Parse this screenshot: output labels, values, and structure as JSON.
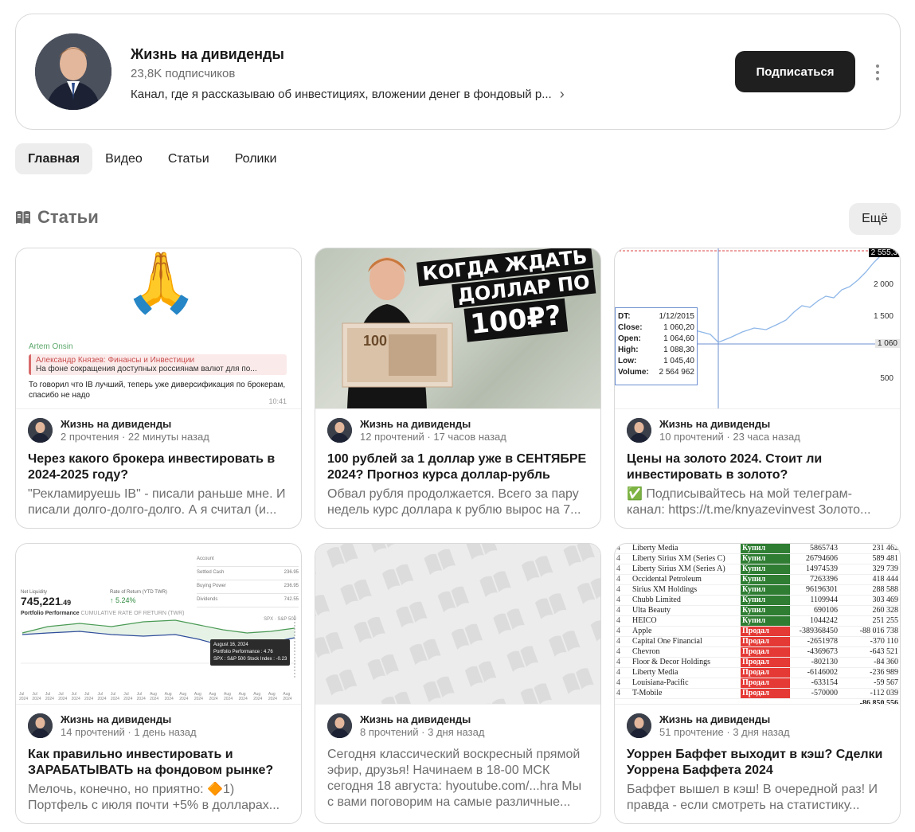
{
  "channel": {
    "title": "Жизнь на дивиденды",
    "subscribers": "23,8K подписчиков",
    "description": "Канал, где я рассказываю об инвестициях, вложении денег в фондовый р...",
    "subscribe_label": "Подписаться"
  },
  "tabs": [
    {
      "label": "Главная",
      "active": true
    },
    {
      "label": "Видео",
      "active": false
    },
    {
      "label": "Статьи",
      "active": false
    },
    {
      "label": "Ролики",
      "active": false
    }
  ],
  "section": {
    "title": "Статьи",
    "more_label": "Ещё",
    "icon": "article-book-icon"
  },
  "articles": [
    {
      "author": "Жизнь на дивиденды",
      "stats": "2 прочтения · 22 минуты назад",
      "title": "Через какого брокера инвестировать в 2024-2025 году?",
      "excerpt": "\"Рекламируешь IB\" - писали раньше мне. И писали долго-долго-долго. А я считал (и...",
      "thumb": {
        "emoji": "🙏",
        "sender": "Artem Onsin",
        "quote_author": "Александр Князев: Финансы и Инвестиции",
        "quote_text": "На фоне сокращения доступных россиянам валют для по...",
        "message": "То говорил что IB лучший, теперь уже диверсификация по брокерам, спасибо не надо",
        "time": "10:41"
      }
    },
    {
      "author": "Жизнь на дивиденды",
      "stats": "12 прочтений · 17 часов назад",
      "title": "100 рублей за 1 доллар уже в СЕНТЯБРЕ 2024? Прогноз курса доллар-рубль",
      "excerpt": "Обвал рубля продолжается. Всего за пару недель курс доллара к рублю вырос на 7...",
      "thumb": {
        "line1": "КОГДА ЖДАТЬ",
        "line2": "ДОЛЛАР ПО",
        "line3": "100₽?",
        "banknote": "100"
      }
    },
    {
      "author": "Жизнь на дивиденды",
      "stats": "10 прочтений · 23 часа назад",
      "title": "Цены на золото 2024. Стоит ли инвестировать в золото?",
      "excerpt": "✅ Подписывайтесь на мой телеграм-канал: https://t.me/knyazevinvest Золото...",
      "thumb": {
        "info": [
          {
            "k": "DT:",
            "v": "1/12/2015"
          },
          {
            "k": "Close:",
            "v": "1 060,20"
          },
          {
            "k": "Open:",
            "v": "1 064,60"
          },
          {
            "k": "High:",
            "v": "1 088,30"
          },
          {
            "k": "Low:",
            "v": "1 045,40"
          },
          {
            "k": "Volume:",
            "v": "2 564 962"
          }
        ],
        "axis": [
          "2 000",
          "1 500",
          "500"
        ],
        "tag_top": "2 555,3",
        "tag_mid": "1 060"
      }
    },
    {
      "author": "Жизнь на дивиденды",
      "stats": "14 прочтений · 1 день назад",
      "title": "Как правильно инвестировать и ЗАРАБАТЫВАТЬ на фондовом рынке?",
      "excerpt": "Мелочь, конечно, но приятно: 🔶1) Портфель с июля почти +5% в долларах...",
      "thumb": {
        "account_title": "Account",
        "account_rows": [
          {
            "k": "Settled Cash",
            "v": "236.95"
          },
          {
            "k": "Buying Power",
            "v": "236.95"
          },
          {
            "k": "Dividends",
            "v": "742.55"
          }
        ],
        "liq_label": "Net Liquidity",
        "liq_value": "745,221",
        "liq_cents": ".49",
        "ret_label": "Rate of Return (YTD TWR)",
        "ret_value": "5.24%",
        "perf_title": "Portfolio Performance",
        "perf_sub": "CUMULATIVE RATE OF RETURN (TWR)",
        "spx": "SPX · S&P 500",
        "tip_date": "August 16, 2024",
        "tip_line1": "Portfolio Performance : 4.76",
        "tip_line2": "SPX : S&P 500 Stock Index : -0.23",
        "months": [
          "Jul 2024",
          "Jul 2024",
          "Jul 2024",
          "Jul 2024",
          "Jul 2024",
          "Jul 2024",
          "Jul 2024",
          "Jul 2024",
          "Jul 2024",
          "Jul 2024",
          "Aug 2024",
          "Aug 2024",
          "Aug 2024",
          "Aug 2024",
          "Aug 2024",
          "Aug 2024",
          "Aug 2024",
          "Aug 2024",
          "Aug 2024",
          "Aug 2024"
        ]
      }
    },
    {
      "author": "Жизнь на дивиденды",
      "stats": "8 прочтений · 3 дня назад",
      "title": "",
      "excerpt": "Сегодня классический воскресный прямой эфир, друзья! Начинаем в 18-00 МСК сегодня 18 августа: hyoutube.com/...hra Мы с вами поговорим на самые различные..."
    },
    {
      "author": "Жизнь на дивиденды",
      "stats": "51 прочтение · 3 дня назад",
      "title": "Уоррен Баффет выходит в кэш? Сделки Уоррена Баффета 2024",
      "excerpt": "Баффет вышел в кэш! В очередной раз! И правда - если смотреть на статистику...",
      "thumb": {
        "rows": [
          {
            "n": "4",
            "company": "Liberty Media",
            "action": "Купил",
            "type": "buy",
            "qty": "5865743",
            "value": "231 462"
          },
          {
            "n": "4",
            "company": "Liberty Sirius XM (Series C)",
            "action": "Купил",
            "type": "buy",
            "qty": "26794606",
            "value": "589 481"
          },
          {
            "n": "4",
            "company": "Liberty Sirius XM (Series A)",
            "action": "Купил",
            "type": "buy",
            "qty": "14974539",
            "value": "329 739"
          },
          {
            "n": "4",
            "company": "Occidental Petroleum",
            "action": "Купил",
            "type": "buy",
            "qty": "7263396",
            "value": "418 444"
          },
          {
            "n": "4",
            "company": "Sirius XM Holdings",
            "action": "Купил",
            "type": "buy",
            "qty": "96196301",
            "value": "288 588"
          },
          {
            "n": "4",
            "company": "Chubb Limited",
            "action": "Купил",
            "type": "buy",
            "qty": "1109944",
            "value": "303 469"
          },
          {
            "n": "4",
            "company": "Ulta Beauty",
            "action": "Купил",
            "type": "buy",
            "qty": "690106",
            "value": "260 328"
          },
          {
            "n": "4",
            "company": "HEICO",
            "action": "Купил",
            "type": "buy",
            "qty": "1044242",
            "value": "251 255"
          },
          {
            "n": "4",
            "company": "Apple",
            "action": "Продал",
            "type": "sell",
            "qty": "-389368450",
            "value": "-88 016 738"
          },
          {
            "n": "4",
            "company": "Capital One Financial",
            "action": "Продал",
            "type": "sell",
            "qty": "-2651978",
            "value": "-370 110"
          },
          {
            "n": "4",
            "company": "Chevron",
            "action": "Продал",
            "type": "sell",
            "qty": "-4369673",
            "value": "-643 521"
          },
          {
            "n": "4",
            "company": "Floor & Decor Holdings",
            "action": "Продал",
            "type": "sell",
            "qty": "-802130",
            "value": "-84 360"
          },
          {
            "n": "4",
            "company": "Liberty Media",
            "action": "Продал",
            "type": "sell",
            "qty": "-6146002",
            "value": "-236 989"
          },
          {
            "n": "4",
            "company": "Louisiana-Pacific",
            "action": "Продал",
            "type": "sell",
            "qty": "-633154",
            "value": "-59 567"
          },
          {
            "n": "4",
            "company": "T-Mobile",
            "action": "Продал",
            "type": "sell",
            "qty": "-570000",
            "value": "-112 039"
          }
        ],
        "total": "-86 850 556"
      }
    }
  ],
  "colors": {
    "accent_dark": "#1f1f1f",
    "buy": "#2e7d32",
    "sell": "#e53935",
    "tab_active_bg": "#ededed"
  }
}
